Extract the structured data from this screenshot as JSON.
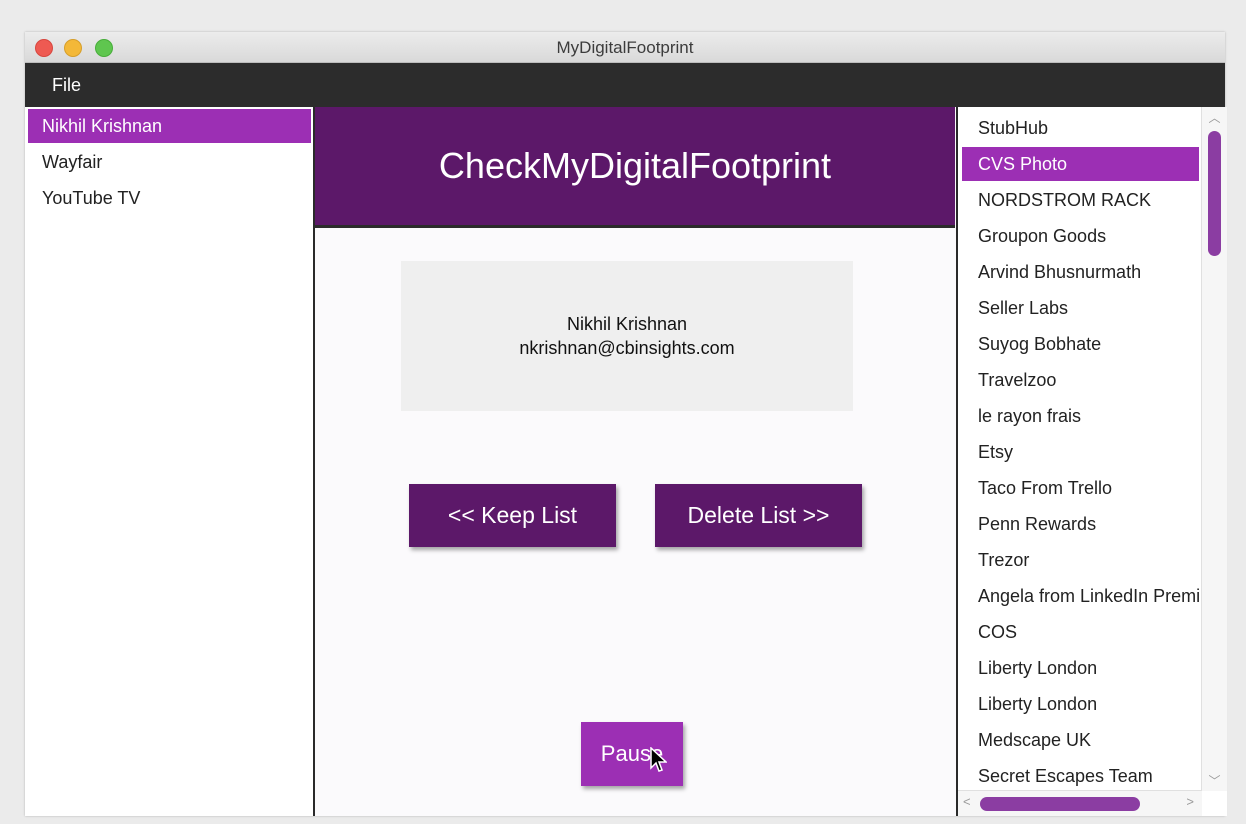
{
  "window": {
    "title": "MyDigitalFootprint"
  },
  "menu": {
    "file_label": "File"
  },
  "left_list": {
    "items": [
      {
        "label": "Nikhil Krishnan",
        "selected": true
      },
      {
        "label": "Wayfair",
        "selected": false
      },
      {
        "label": "YouTube TV",
        "selected": false
      }
    ]
  },
  "header": {
    "title": "CheckMyDigitalFootprint"
  },
  "account": {
    "name": "Nikhil Krishnan",
    "email": "nkrishnan@cbinsights.com"
  },
  "actions": {
    "keep_label": "<<  Keep List",
    "delete_label": "Delete List >>",
    "pause_label": "Pause"
  },
  "right_list": {
    "items": [
      {
        "label": "StubHub",
        "selected": false
      },
      {
        "label": "CVS Photo",
        "selected": true
      },
      {
        "label": "NORDSTROM RACK",
        "selected": false
      },
      {
        "label": "Groupon Goods",
        "selected": false
      },
      {
        "label": "Arvind Bhusnurmath",
        "selected": false
      },
      {
        "label": "Seller Labs",
        "selected": false
      },
      {
        "label": "Suyog Bobhate",
        "selected": false
      },
      {
        "label": "Travelzoo",
        "selected": false
      },
      {
        "label": "le rayon frais",
        "selected": false
      },
      {
        "label": "Etsy",
        "selected": false
      },
      {
        "label": "Taco From Trello",
        "selected": false
      },
      {
        "label": "Penn Rewards",
        "selected": false
      },
      {
        "label": "Trezor",
        "selected": false
      },
      {
        "label": "Angela from LinkedIn Premium",
        "selected": false
      },
      {
        "label": "COS",
        "selected": false
      },
      {
        "label": "Liberty London",
        "selected": false
      },
      {
        "label": "Liberty London",
        "selected": false
      },
      {
        "label": "Medscape UK",
        "selected": false
      },
      {
        "label": "Secret Escapes Team",
        "selected": false
      }
    ]
  },
  "colors": {
    "accent_dark": "#5c1869",
    "accent_light": "#9c2fb4",
    "menubar": "#2c2c2c"
  },
  "icons": {
    "cursor": "pointer-cursor-icon"
  }
}
